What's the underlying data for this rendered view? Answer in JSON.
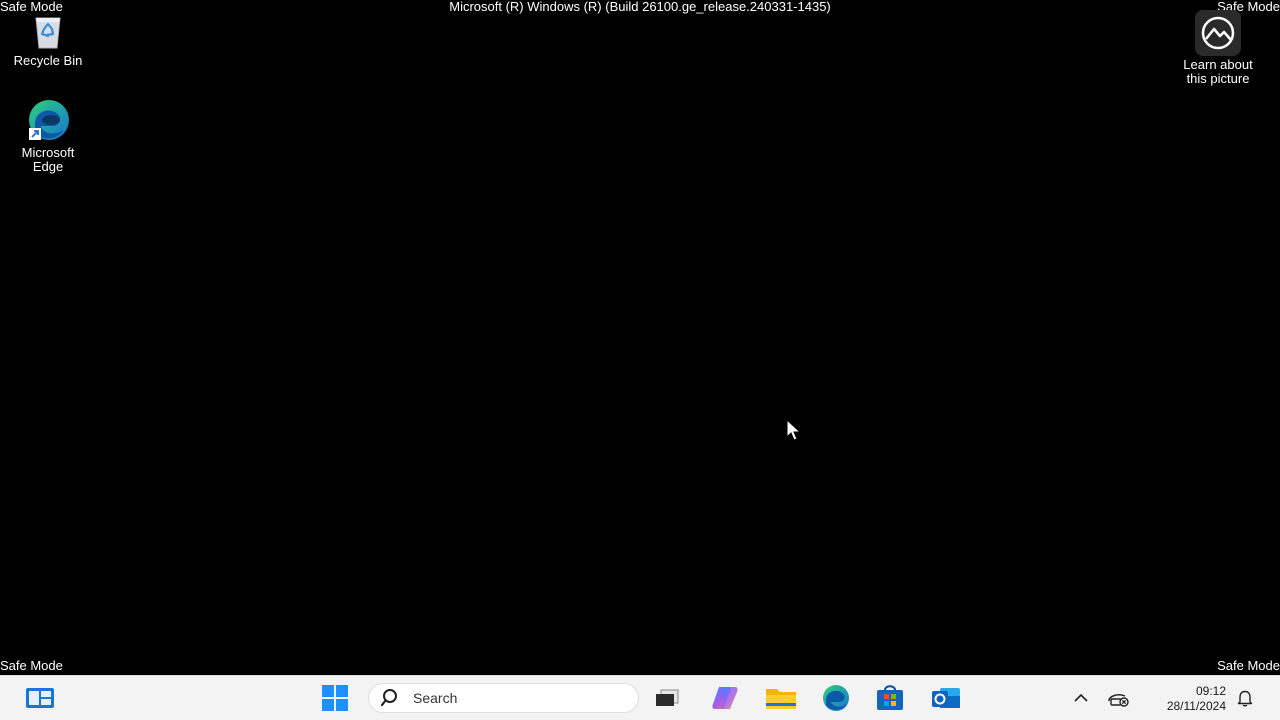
{
  "overlay": {
    "build": "Microsoft (R) Windows (R) (Build 26100.ge_release.240331-1435)",
    "safe_mode": "Safe Mode"
  },
  "desktop": {
    "icons": [
      {
        "label": "Recycle Bin",
        "icon": "recycle-bin-icon"
      },
      {
        "label": "Microsoft\nEdge",
        "icon": "edge-icon"
      },
      {
        "label": "Learn about\nthis picture",
        "icon": "learn-about-picture-icon"
      }
    ]
  },
  "taskbar": {
    "search_placeholder": "Search",
    "apps": [
      "widgets-icon",
      "start-icon",
      "search-icon",
      "task-view-icon",
      "copilot-icon",
      "file-explorer-icon",
      "edge-icon",
      "store-icon",
      "outlook-icon"
    ],
    "tray": {
      "time": "09:12",
      "date": "28/11/2024"
    }
  }
}
